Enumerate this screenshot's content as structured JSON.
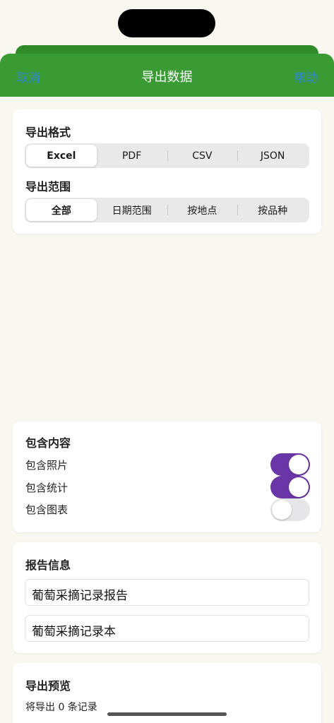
{
  "nav": {
    "cancel": "取消",
    "title": "导出数据",
    "help": "帮助"
  },
  "format": {
    "title": "导出格式",
    "options": [
      "Excel",
      "PDF",
      "CSV",
      "JSON"
    ],
    "selected": "Excel"
  },
  "range": {
    "title": "导出范围",
    "options": [
      "全部",
      "日期范围",
      "按地点",
      "按品种"
    ],
    "selected": "全部"
  },
  "include": {
    "title": "包含内容",
    "items": [
      {
        "label": "包含照片",
        "on": true
      },
      {
        "label": "包含统计",
        "on": true
      },
      {
        "label": "包含图表",
        "on": false
      }
    ]
  },
  "report": {
    "title": "报告信息",
    "report_title_value": "葡萄采摘记录报告",
    "author_value": "葡萄采摘记录本"
  },
  "preview": {
    "title": "导出预览",
    "summary": "将导出 0 条记录"
  },
  "colors": {
    "nav_green": "#3a9b34",
    "link_blue": "#2e86d0",
    "toggle_purple": "#6a35a6",
    "background": "#f8f8f1"
  }
}
